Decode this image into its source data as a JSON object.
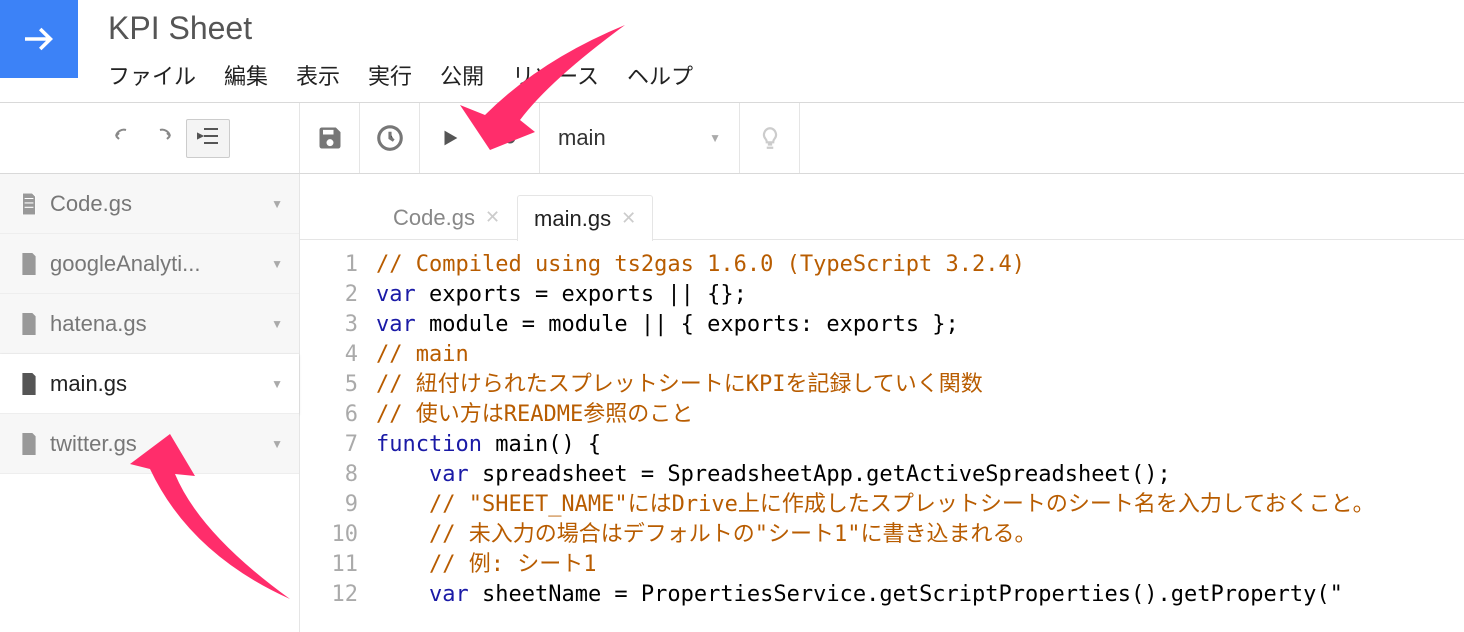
{
  "title": "KPI Sheet",
  "menu": {
    "file": "ファイル",
    "edit": "編集",
    "view": "表示",
    "run": "実行",
    "publish": "公開",
    "resource": "リソース",
    "help": "ヘルプ"
  },
  "toolbar": {
    "selected_function": "main"
  },
  "files": [
    {
      "name": "Code.gs"
    },
    {
      "name": "googleAnalyti..."
    },
    {
      "name": "hatena.gs"
    },
    {
      "name": "main.gs"
    },
    {
      "name": "twitter.gs"
    }
  ],
  "tabs": [
    {
      "name": "Code.gs",
      "active": false
    },
    {
      "name": "main.gs",
      "active": true
    }
  ],
  "code": {
    "lines": [
      {
        "n": 1,
        "tokens": [
          {
            "t": "// Compiled using ts2gas 1.6.0 (TypeScript 3.2.4)",
            "c": "c"
          }
        ]
      },
      {
        "n": 2,
        "tokens": [
          {
            "t": "var",
            "c": "k"
          },
          {
            "t": " exports = exports || {};",
            "c": ""
          }
        ]
      },
      {
        "n": 3,
        "tokens": [
          {
            "t": "var",
            "c": "k"
          },
          {
            "t": " module = module || { exports: exports };",
            "c": ""
          }
        ]
      },
      {
        "n": 4,
        "tokens": [
          {
            "t": "// main",
            "c": "c"
          }
        ]
      },
      {
        "n": 5,
        "tokens": [
          {
            "t": "// 紐付けられたスプレットシートにKPIを記録していく関数",
            "c": "c"
          }
        ]
      },
      {
        "n": 6,
        "tokens": [
          {
            "t": "// 使い方はREADME参照のこと",
            "c": "c"
          }
        ]
      },
      {
        "n": 7,
        "tokens": [
          {
            "t": "function",
            "c": "k"
          },
          {
            "t": " main() {",
            "c": ""
          }
        ]
      },
      {
        "n": 8,
        "tokens": [
          {
            "t": "    ",
            "c": ""
          },
          {
            "t": "var",
            "c": "k"
          },
          {
            "t": " spreadsheet = SpreadsheetApp.getActiveSpreadsheet();",
            "c": ""
          }
        ]
      },
      {
        "n": 9,
        "tokens": [
          {
            "t": "    ",
            "c": ""
          },
          {
            "t": "// \"SHEET_NAME\"にはDrive上に作成したスプレットシートのシート名を入力しておくこと。",
            "c": "c"
          }
        ]
      },
      {
        "n": 10,
        "tokens": [
          {
            "t": "    ",
            "c": ""
          },
          {
            "t": "// 未入力の場合はデフォルトの\"シート1\"に書き込まれる。",
            "c": "c"
          }
        ]
      },
      {
        "n": 11,
        "tokens": [
          {
            "t": "    ",
            "c": ""
          },
          {
            "t": "// 例: シート1",
            "c": "c"
          }
        ]
      },
      {
        "n": 12,
        "tokens": [
          {
            "t": "    ",
            "c": ""
          },
          {
            "t": "var",
            "c": "k"
          },
          {
            "t": " sheetName = PropertiesService.getScriptProperties().getProperty(\"",
            "c": ""
          }
        ]
      }
    ]
  }
}
